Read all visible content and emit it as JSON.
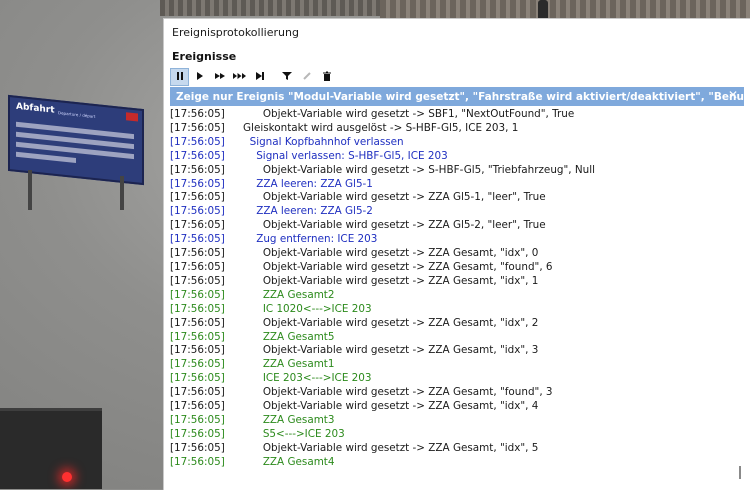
{
  "board": {
    "title": "Abfahrt",
    "subtitle": "Departure / départ"
  },
  "window": {
    "title": "Ereignisprotokollierung",
    "section": "Ereignisse"
  },
  "toolbar": {
    "pause_icon": "pause-icon",
    "play_icon": "play-icon",
    "fast_forward_icon": "fast-forward-icon",
    "faster_forward_icon": "faster-forward-icon",
    "step_end_icon": "step-end-icon",
    "filter_icon": "filter-icon",
    "edit_icon": "edit-icon",
    "delete_icon": "trash-icon"
  },
  "filter_bar": {
    "text": "Zeige nur Ereignis \"Modul-Variable wird gesetzt\", \"Fahrstraße wird aktiviert/deaktiviert\", \"Benutzerdefiniert\", ...",
    "close": "✕"
  },
  "log": [
    {
      "ts": "[17:56:05]",
      "text": "      Objekt-Variable wird gesetzt -> SBF1, \"NextOutFound\", True",
      "color": "black"
    },
    {
      "ts": "[17:56:05]",
      "text": "Gleiskontakt wird ausgelöst -> S-HBF-Gl5, ICE 203, 1",
      "color": "black"
    },
    {
      "ts": "[17:56:05]",
      "text": "  Signal Kopfbahnhof verlassen",
      "color": "blue"
    },
    {
      "ts": "[17:56:05]",
      "text": "    Signal verlassen: S-HBF-Gl5, ICE 203",
      "color": "blue"
    },
    {
      "ts": "[17:56:05]",
      "text": "      Objekt-Variable wird gesetzt -> S-HBF-Gl5, \"Triebfahrzeug\", Null",
      "color": "black"
    },
    {
      "ts": "[17:56:05]",
      "text": "    ZZA leeren: ZZA Gl5-1",
      "color": "blue"
    },
    {
      "ts": "[17:56:05]",
      "text": "      Objekt-Variable wird gesetzt -> ZZA Gl5-1, \"leer\", True",
      "color": "black"
    },
    {
      "ts": "[17:56:05]",
      "text": "    ZZA leeren: ZZA Gl5-2",
      "color": "blue"
    },
    {
      "ts": "[17:56:05]",
      "text": "      Objekt-Variable wird gesetzt -> ZZA Gl5-2, \"leer\", True",
      "color": "black"
    },
    {
      "ts": "[17:56:05]",
      "text": "    Zug entfernen: ICE 203",
      "color": "blue"
    },
    {
      "ts": "[17:56:05]",
      "text": "      Objekt-Variable wird gesetzt -> ZZA Gesamt, \"idx\", 0",
      "color": "black"
    },
    {
      "ts": "[17:56:05]",
      "text": "      Objekt-Variable wird gesetzt -> ZZA Gesamt, \"found\", 6",
      "color": "black"
    },
    {
      "ts": "[17:56:05]",
      "text": "      Objekt-Variable wird gesetzt -> ZZA Gesamt, \"idx\", 1",
      "color": "black"
    },
    {
      "ts": "[17:56:05]",
      "text": "      ZZA Gesamt2",
      "color": "green"
    },
    {
      "ts": "[17:56:05]",
      "text": "      IC 1020<--->ICE 203",
      "color": "green"
    },
    {
      "ts": "[17:56:05]",
      "text": "      Objekt-Variable wird gesetzt -> ZZA Gesamt, \"idx\", 2",
      "color": "black"
    },
    {
      "ts": "[17:56:05]",
      "text": "      ZZA Gesamt5",
      "color": "green"
    },
    {
      "ts": "[17:56:05]",
      "text": "      Objekt-Variable wird gesetzt -> ZZA Gesamt, \"idx\", 3",
      "color": "black"
    },
    {
      "ts": "[17:56:05]",
      "text": "      ZZA Gesamt1",
      "color": "green"
    },
    {
      "ts": "[17:56:05]",
      "text": "      ICE 203<--->ICE 203",
      "color": "green"
    },
    {
      "ts": "[17:56:05]",
      "text": "      Objekt-Variable wird gesetzt -> ZZA Gesamt, \"found\", 3",
      "color": "black"
    },
    {
      "ts": "[17:56:05]",
      "text": "      Objekt-Variable wird gesetzt -> ZZA Gesamt, \"idx\", 4",
      "color": "black"
    },
    {
      "ts": "[17:56:05]",
      "text": "      ZZA Gesamt3",
      "color": "green"
    },
    {
      "ts": "[17:56:05]",
      "text": "      S5<--->ICE 203",
      "color": "green"
    },
    {
      "ts": "[17:56:05]",
      "text": "      Objekt-Variable wird gesetzt -> ZZA Gesamt, \"idx\", 5",
      "color": "black"
    },
    {
      "ts": "[17:56:05]",
      "text": "      ZZA Gesamt4",
      "color": "green"
    }
  ]
}
